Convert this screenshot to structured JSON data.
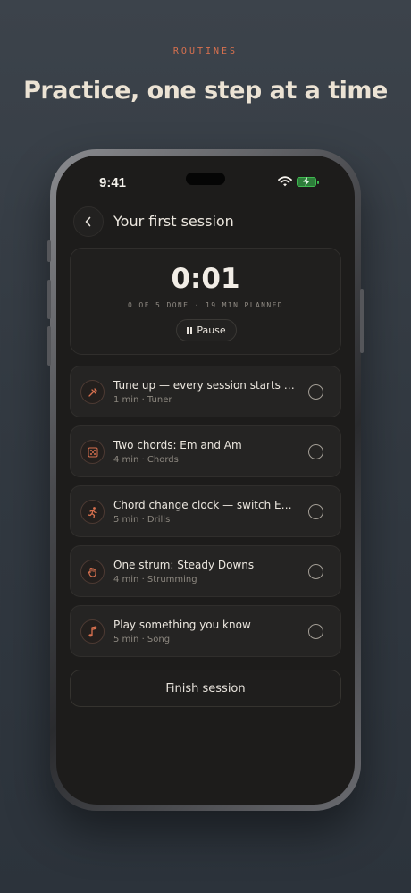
{
  "header": {
    "eyebrow": "ROUTINES",
    "headline": "Practice, one step at a time"
  },
  "status_bar": {
    "time": "9:41",
    "wifi_icon": "wifi-icon",
    "battery_icon": "battery-charging-icon",
    "battery_color": "#3fb950"
  },
  "nav": {
    "back_icon": "chevron-left-icon",
    "title": "Your first session"
  },
  "timer": {
    "value": "0:01",
    "meta": "0 OF 5 DONE · 19 MIN PLANNED",
    "pause_label": "Pause",
    "pause_icon": "pause-icon"
  },
  "steps": [
    {
      "title": "Tune up — every session starts h...",
      "meta": "1 min · Tuner",
      "icon": "tuning-fork-icon",
      "done": false
    },
    {
      "title": "Two chords: Em and Am",
      "meta": "4 min · Chords",
      "icon": "chord-grid-icon",
      "done": false
    },
    {
      "title": "Chord change clock — switch Em...",
      "meta": "5 min · Drills",
      "icon": "running-icon",
      "done": false
    },
    {
      "title": "One strum: Steady Downs",
      "meta": "4 min · Strumming",
      "icon": "hand-strum-icon",
      "done": false
    },
    {
      "title": "Play something you know",
      "meta": "5 min · Song",
      "icon": "music-note-icon",
      "done": false
    }
  ],
  "finish_label": "Finish session",
  "colors": {
    "accent": "#d9714f",
    "background": "#1d1c1b",
    "headline": "#ece3d4"
  }
}
